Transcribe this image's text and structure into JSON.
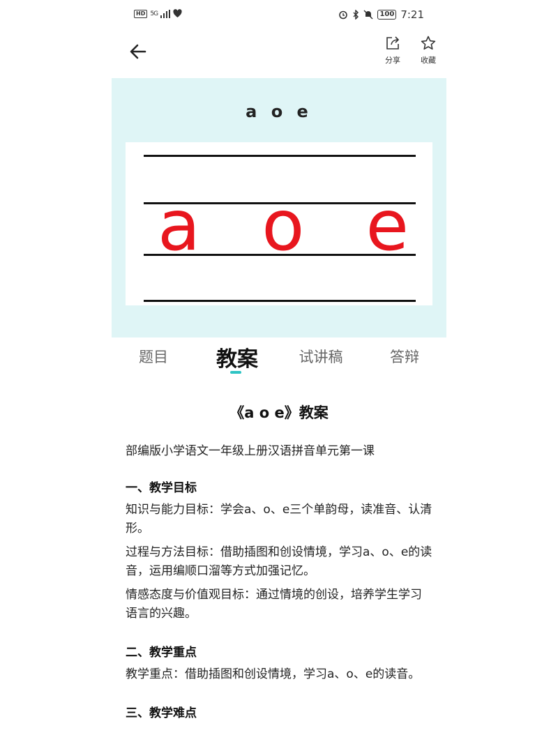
{
  "status_bar": {
    "network_badge": "HD",
    "signal": "5G",
    "battery": "100",
    "time": "7:21"
  },
  "header": {
    "share_label": "分享",
    "favorite_label": "收藏"
  },
  "hero": {
    "title": "a o e",
    "letters": [
      "a",
      "o",
      "e"
    ]
  },
  "tabs": [
    {
      "label": "题目"
    },
    {
      "label": "教案"
    },
    {
      "label": "试讲稿"
    },
    {
      "label": "答辩"
    }
  ],
  "active_tab": "教案",
  "content": {
    "title": "《a o e》教案",
    "subtitle": "部编版小学语文一年级上册汉语拼音单元第一课",
    "sections": [
      {
        "heading": "一、教学目标",
        "paragraphs": [
          "知识与能力目标：学会a、o、e三个单韵母，读准音、认清形。",
          "过程与方法目标：借助插图和创设情境，学习a、o、e的读音，运用编顺口溜等方式加强记忆。",
          "情感态度与价值观目标：通过情境的创设，培养学生学习语言的兴趣。"
        ]
      },
      {
        "heading": "二、教学重点",
        "paragraphs": [
          "教学重点：借助插图和创设情境，学习a、o、e的读音。"
        ]
      },
      {
        "heading": "三、教学难点",
        "paragraphs": []
      }
    ]
  },
  "colors": {
    "accent": "#2ec4c4",
    "hero_bg": "#dff5f6",
    "pinyin_red": "#e8161e"
  }
}
